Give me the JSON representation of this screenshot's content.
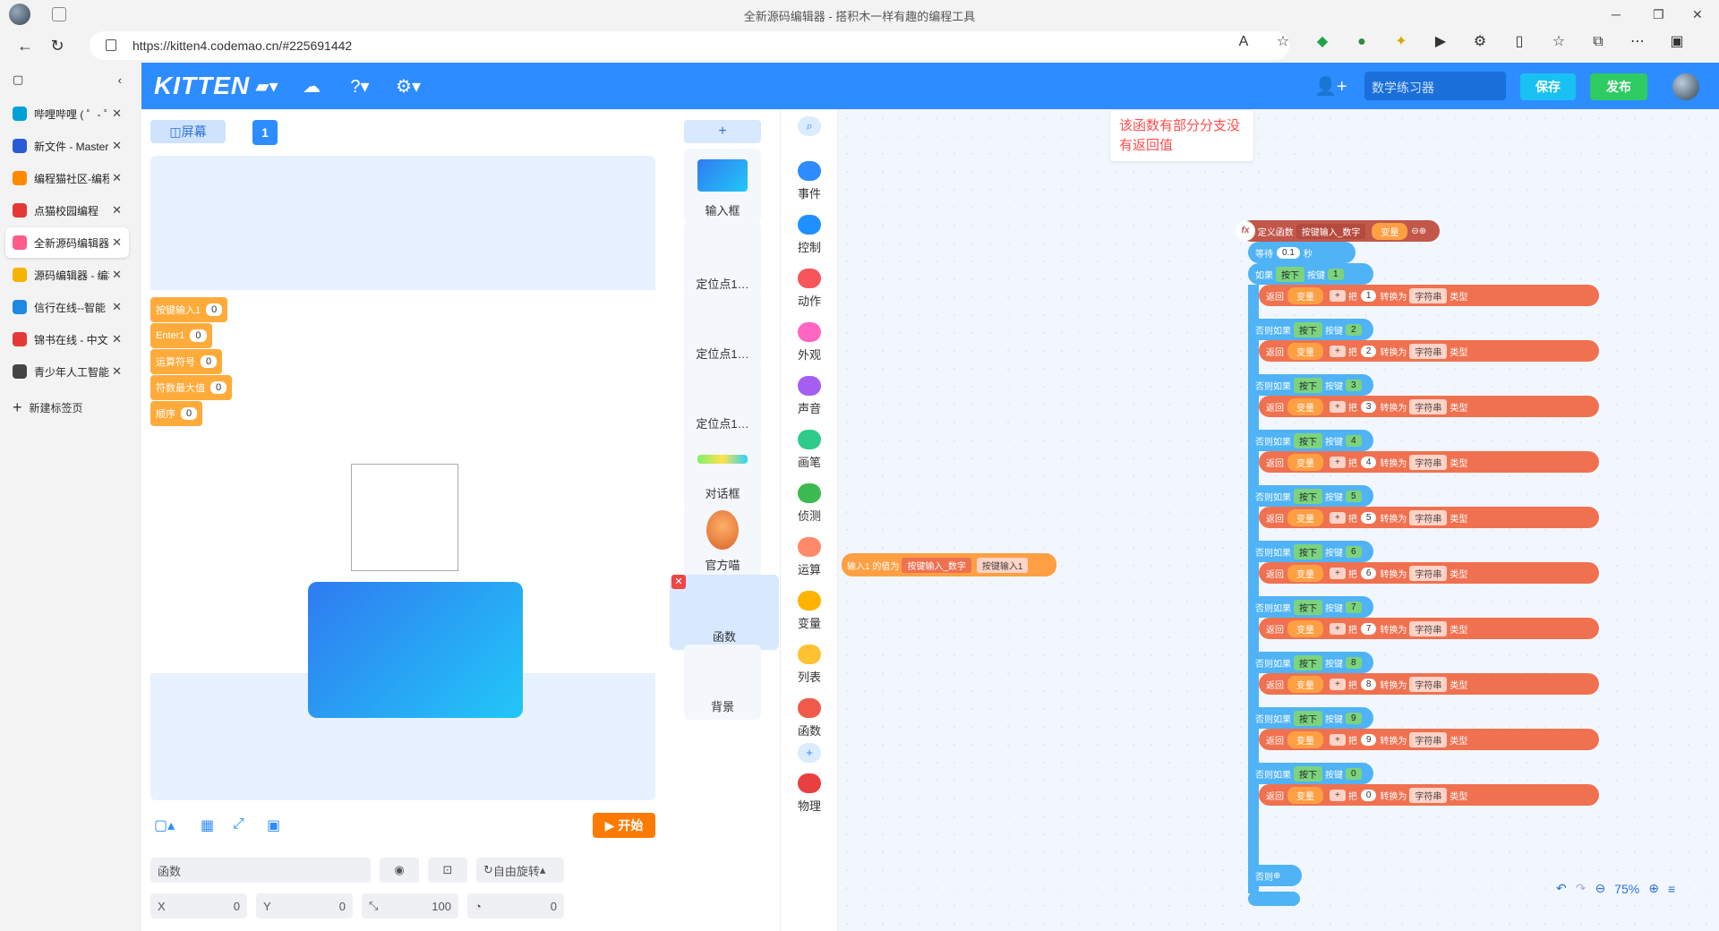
{
  "browser": {
    "title": "全新源码编辑器 - 搭积木一样有趣的编程工具",
    "url": "https://kitten4.codemao.cn/#225691442"
  },
  "tabs": [
    {
      "label": "哔哩哔哩 ( ゜- ゜",
      "color": "#00a1d6"
    },
    {
      "label": "新文件 - Master",
      "color": "#2a5bd7"
    },
    {
      "label": "编程猫社区-编程",
      "color": "#ff8a00"
    },
    {
      "label": "点猫校园编程",
      "color": "#e53935"
    },
    {
      "label": "全新源码编辑器",
      "color": "#ff5c8a",
      "active": true
    },
    {
      "label": "源码编辑器 - 编程",
      "color": "#f5b400"
    },
    {
      "label": "信行在线--智能",
      "color": "#1e88e5"
    },
    {
      "label": "锦书在线 - 中文",
      "color": "#e53935"
    },
    {
      "label": "青少年人工智能",
      "color": "#444444"
    }
  ],
  "newtab": "新建标签页",
  "app": {
    "logo": "KITTEN",
    "project_name": "数学练习器",
    "save": "保存",
    "publish": "发布"
  },
  "stage": {
    "screen_btn": "屏幕",
    "page": "1",
    "start": "开始",
    "vars": [
      {
        "name": "按键输入1",
        "value": "0"
      },
      {
        "name": "Enter1",
        "value": "0"
      },
      {
        "name": "运算符号",
        "value": "0"
      },
      {
        "name": "符数最大值",
        "value": "0"
      },
      {
        "name": "顺序",
        "value": "0"
      }
    ]
  },
  "props": {
    "name": "函数",
    "rotate": "自由旋转",
    "x_label": "X",
    "x": "0",
    "y_label": "Y",
    "y": "0",
    "size": "100",
    "angle": "0"
  },
  "sprites": [
    "输入框",
    "定位点1…",
    "定位点1…",
    "定位点1…",
    "对话框",
    "官方喵",
    "函数",
    "背景"
  ],
  "categories": [
    {
      "label": "事件",
      "color": "#2d8cff"
    },
    {
      "label": "控制",
      "color": "#1e90ff"
    },
    {
      "label": "动作",
      "color": "#f5555b"
    },
    {
      "label": "外观",
      "color": "#ff66c4"
    },
    {
      "label": "声音",
      "color": "#a45ff0"
    },
    {
      "label": "画笔",
      "color": "#2ecb8a"
    },
    {
      "label": "侦测",
      "color": "#3dba4f"
    },
    {
      "label": "运算",
      "color": "#ff8a6a"
    },
    {
      "label": "变量",
      "color": "#ffb300"
    },
    {
      "label": "列表",
      "color": "#ffc233"
    },
    {
      "label": "函数",
      "color": "#f05a4a"
    },
    {
      "label": "物理",
      "color": "#e84040"
    }
  ],
  "workspace": {
    "tip": "该函数有部分分支没有返回值",
    "def_label": "定义函数",
    "def_name": "按键输入_数字",
    "def_param": "变量",
    "wait": "等待",
    "wait_val": "0.1",
    "wait_unit": "秒",
    "if": "如果",
    "elif": "否则如果",
    "else": "否则",
    "press": "按下",
    "key": "按键",
    "ret": "返回",
    "var": "变量",
    "to": "把",
    "conv": "转换为",
    "str": "字符串",
    "type": "类型",
    "keys": [
      "1",
      "2",
      "3",
      "4",
      "5",
      "6",
      "7",
      "8",
      "9",
      "0"
    ],
    "float_a": "输入1",
    "float_b": "的值为",
    "float_c": "按键输入_数字",
    "float_d": "按键输入1",
    "zoom": "75%"
  }
}
